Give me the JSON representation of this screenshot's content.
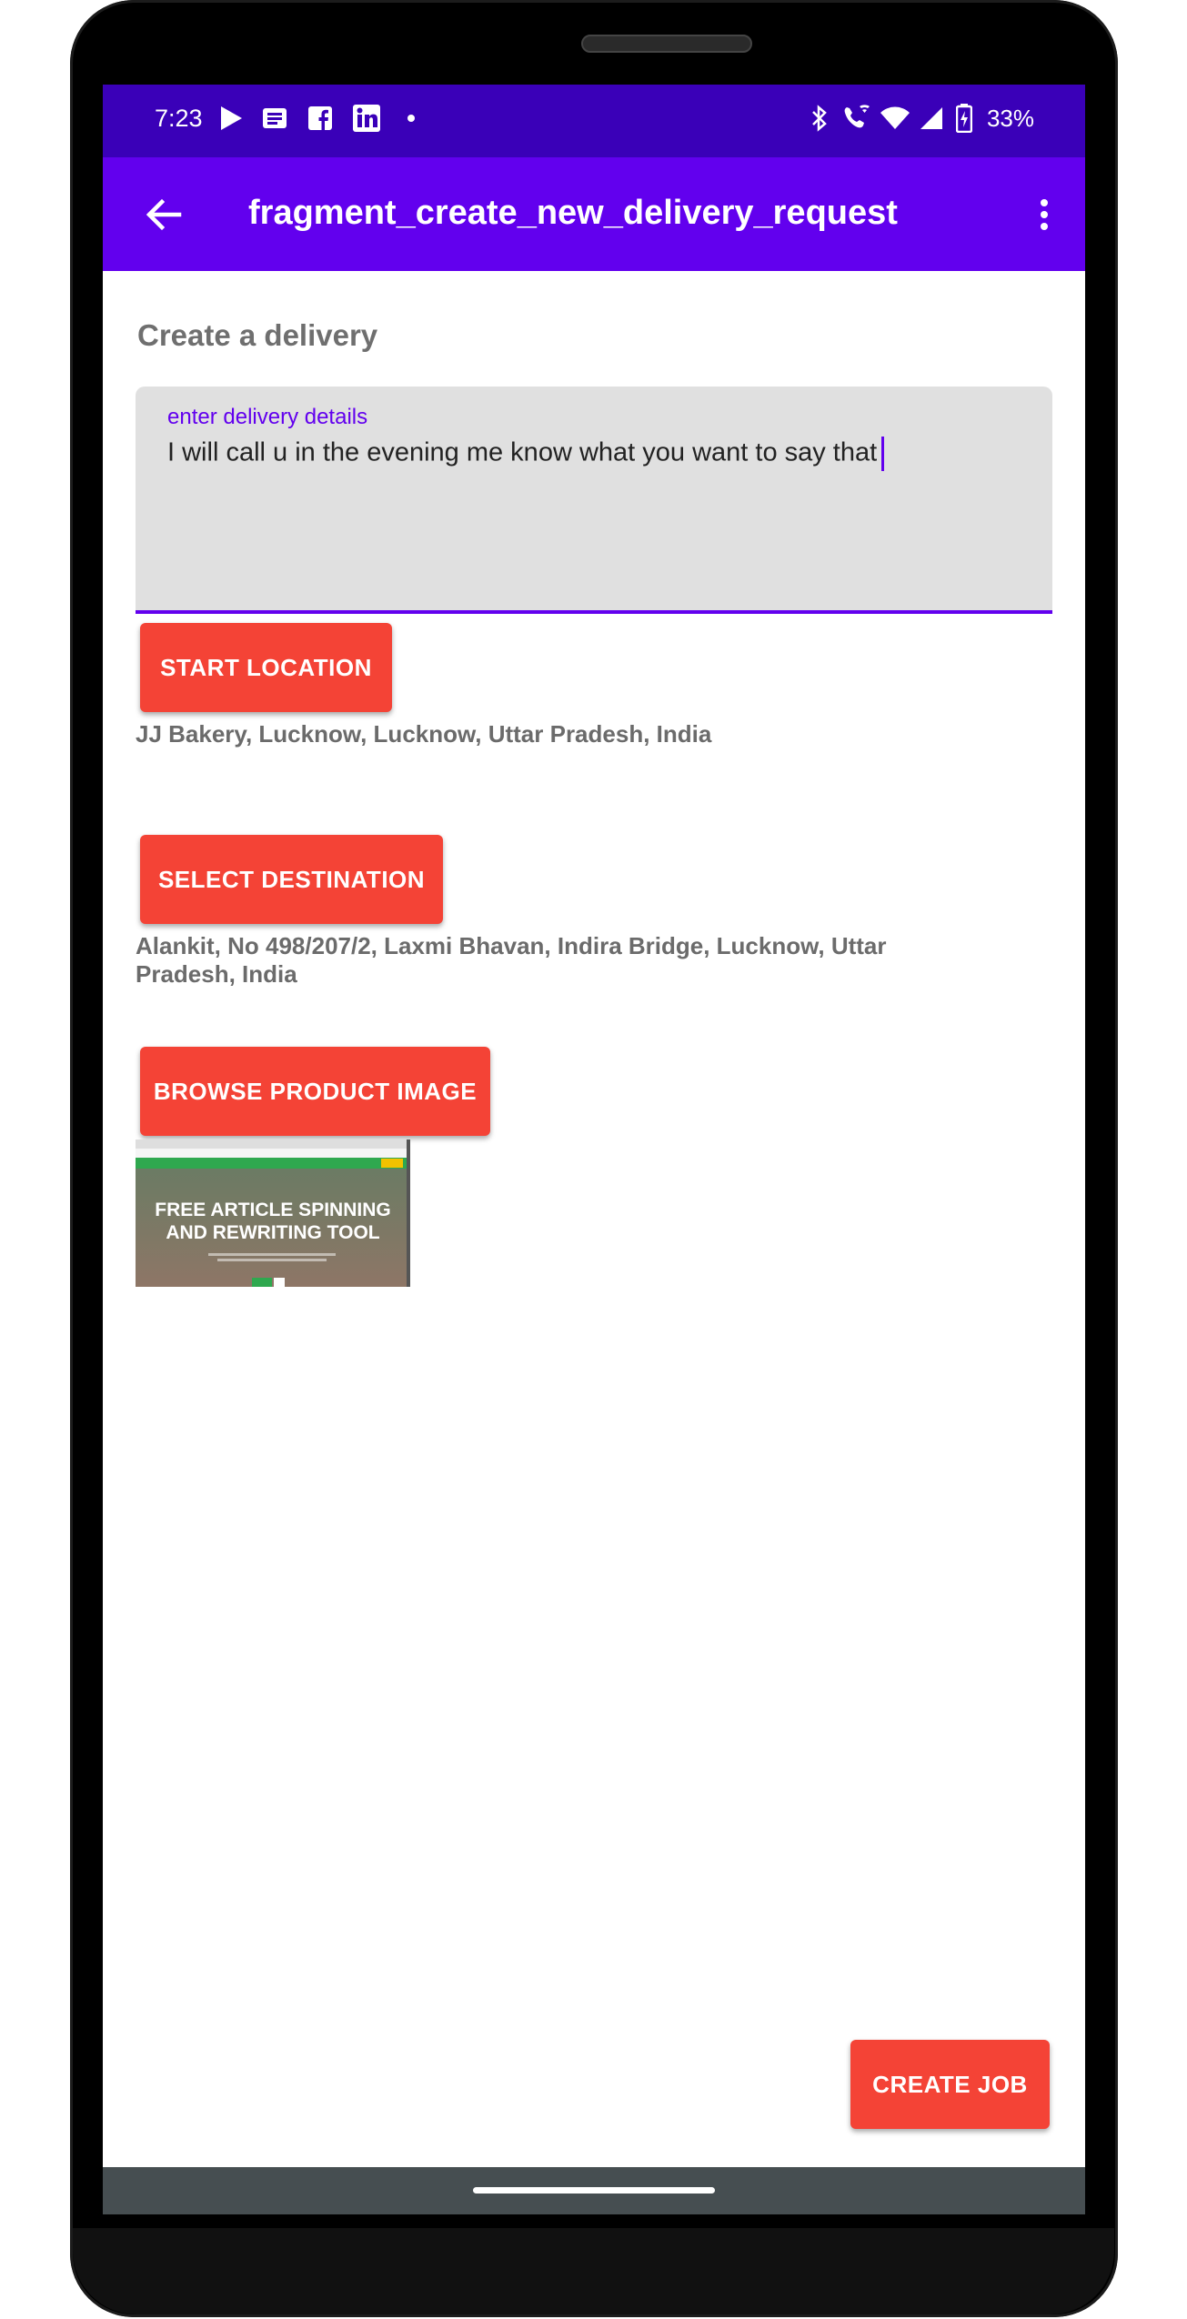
{
  "status_bar": {
    "time": "7:23",
    "battery_percent": "33%",
    "left_icons": [
      "play-store-icon",
      "news-icon",
      "facebook-icon",
      "linkedin-icon",
      "more-notifications-dot-icon"
    ],
    "right_icons": [
      "bluetooth-icon",
      "wifi-calling-icon",
      "wifi-icon",
      "signal-icon",
      "battery-icon"
    ]
  },
  "app_bar": {
    "title": "fragment_create_new_delivery_request",
    "background": "#6200ee"
  },
  "form": {
    "heading": "Create a delivery",
    "details_label": "enter delivery details",
    "details_value": "I will call u in the evening me know what you want to say that",
    "start_button": "START LOCATION",
    "start_address": "JJ Bakery, Lucknow, Lucknow, Uttar Pradesh, India",
    "destination_button": "SELECT DESTINATION",
    "destination_address": "Alankit, No 498/207/2, Laxmi Bhavan, Indira Bridge, Lucknow, Uttar Pradesh, India",
    "browse_button": "BROWSE PRODUCT IMAGE",
    "image_preview_text": "FREE ARTICLE SPINNING AND REWRITING TOOL",
    "create_button": "CREATE JOB",
    "button_color": "#f44336"
  }
}
